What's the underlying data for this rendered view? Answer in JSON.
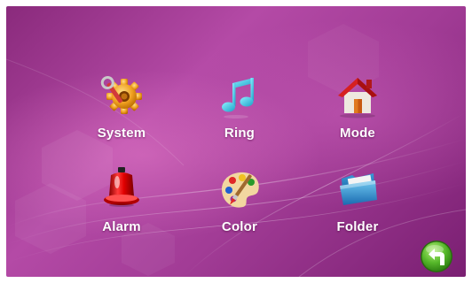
{
  "menu": {
    "items": [
      {
        "id": "system",
        "label": "System",
        "icon": "gear-icon"
      },
      {
        "id": "ring",
        "label": "Ring",
        "icon": "music-note-icon"
      },
      {
        "id": "mode",
        "label": "Mode",
        "icon": "house-icon"
      },
      {
        "id": "alarm",
        "label": "Alarm",
        "icon": "alarm-siren-icon"
      },
      {
        "id": "color",
        "label": "Color",
        "icon": "paint-palette-icon"
      },
      {
        "id": "folder",
        "label": "Folder",
        "icon": "folder-icon"
      }
    ]
  },
  "back_button": {
    "icon": "back-arrow-icon"
  },
  "colors": {
    "background": "#a23c96",
    "label_text": "#ffffff",
    "back_button": "#4caf2a"
  }
}
